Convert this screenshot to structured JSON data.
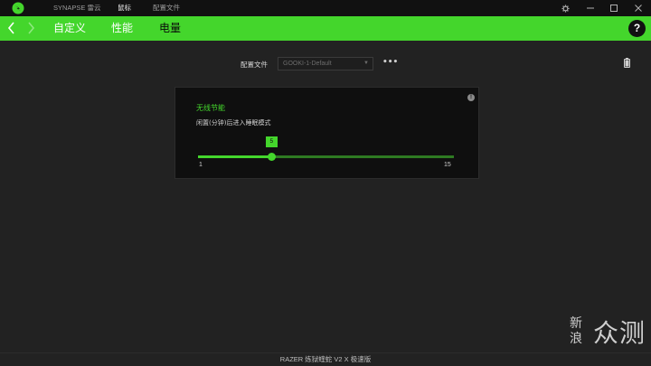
{
  "titlebar": {
    "items": [
      {
        "label": "SYNAPSE 雷云",
        "active": false
      },
      {
        "label": "鼠标",
        "active": true
      },
      {
        "label": "配置文件",
        "active": false
      }
    ],
    "controls": {
      "settings": "gear-icon",
      "minimize": "minimize-icon",
      "maximize": "maximize-icon",
      "close": "close-icon"
    }
  },
  "nav": {
    "tabs": [
      {
        "label": "自定义",
        "active": false
      },
      {
        "label": "性能",
        "active": false
      },
      {
        "label": "电量",
        "active": true
      }
    ],
    "help_label": "?"
  },
  "profile": {
    "label": "配置文件",
    "selected": "GOOKI-1-Default",
    "more_label": "•••"
  },
  "panel": {
    "title": "无线节能",
    "subtitle": "闲置(分钟)后进入睡眠模式",
    "slider": {
      "min": 1,
      "max": 15,
      "value": 5,
      "min_label": "1",
      "max_label": "15",
      "value_label": "5"
    }
  },
  "footer": {
    "device": "RAZER 炼狱蝰蛇 V2 X 极速版"
  },
  "watermark": {
    "line1": "新浪",
    "line2": "众测"
  },
  "colors": {
    "accent": "#44d62c",
    "background": "#222222",
    "panel": "#0f0f0f",
    "titlebar": "#111111"
  }
}
